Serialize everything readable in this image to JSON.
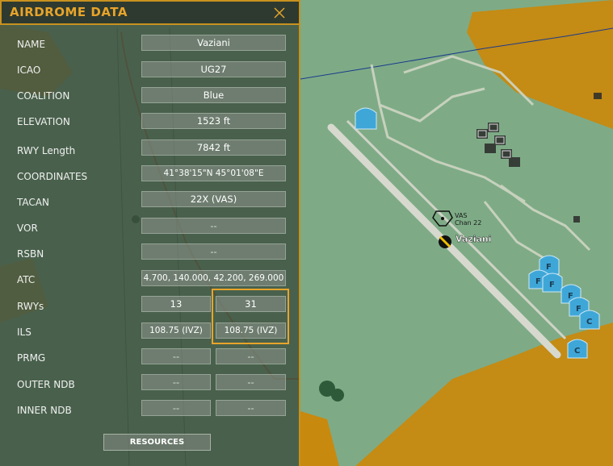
{
  "panel": {
    "title": "AIRDROME DATA",
    "close_icon": "close-x-icon",
    "accent_color": "#e8a42a"
  },
  "fields": [
    {
      "label": "NAME",
      "value": "Vaziani"
    },
    {
      "label": "ICAO",
      "value": "UG27"
    },
    {
      "label": "COALITION",
      "value": "Blue"
    },
    {
      "label": "ELEVATION",
      "value": "1523 ft"
    },
    {
      "label": "RWY Length",
      "value": "7842 ft"
    },
    {
      "label": "COORDINATES",
      "value": "41°38'15\"N 45°01'08\"E"
    },
    {
      "label": "TACAN",
      "value": "22X (VAS)"
    },
    {
      "label": "VOR",
      "value": "--"
    },
    {
      "label": "RSBN",
      "value": "--"
    },
    {
      "label": "ATC",
      "value": "4.700, 140.000, 42.200, 269.000"
    }
  ],
  "runway_rows": [
    {
      "label": "RWYs",
      "left": "13",
      "right": "31"
    },
    {
      "label": "ILS",
      "left": "108.75 (IVZ)",
      "right": "108.75 (IVZ)"
    },
    {
      "label": "PRMG",
      "left": "--",
      "right": "--"
    },
    {
      "label": "OUTER NDB",
      "left": "--",
      "right": "--"
    },
    {
      "label": "INNER NDB",
      "left": "--",
      "right": "--"
    }
  ],
  "resources_button": "RESOURCES",
  "map": {
    "airfield_name": "Vaziani",
    "tacan_label_1": "VAS",
    "tacan_label_2": "Chan 22",
    "parking_labels": [
      "F",
      "F",
      "F",
      "F",
      "F",
      "C",
      "C"
    ]
  }
}
